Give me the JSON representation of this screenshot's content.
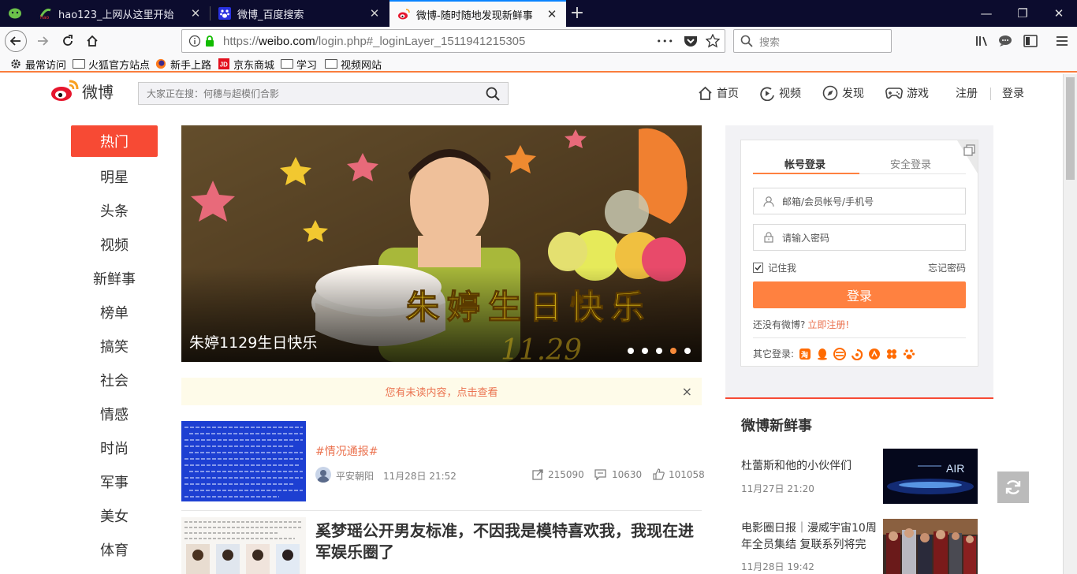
{
  "browser": {
    "tabs": [
      {
        "title": "hao123_上网从这里开始",
        "active": false
      },
      {
        "title": "微博_百度搜索",
        "active": false
      },
      {
        "title": "微博-随时随地发现新鲜事",
        "active": true
      }
    ],
    "new_tab": "+",
    "url_host_prefix": "https://",
    "url_host": "weibo.com",
    "url_path": "/login.php#_loginLayer_1511941215305",
    "search_placeholder": "搜索",
    "url_more": "•••",
    "bookmarks": [
      "最常访问",
      "火狐官方站点",
      "新手上路",
      "京东商城",
      "学习",
      "视频网站"
    ]
  },
  "weibo": {
    "logo_text": "微博",
    "search_placeholder": "大家正在搜：何穗与超模们合影",
    "topnav": [
      "首页",
      "视频",
      "发现",
      "游戏",
      "注册",
      "登录"
    ],
    "categories": [
      "热门",
      "明星",
      "头条",
      "视频",
      "新鲜事",
      "榜单",
      "搞笑",
      "社会",
      "情感",
      "时尚",
      "军事",
      "美女",
      "体育"
    ],
    "carousel": {
      "caption": "朱婷1129生日快乐",
      "overlay": "朱婷生日快乐",
      "date_hint": "11.29",
      "dots": 5,
      "active_dot": 3
    },
    "notice": {
      "text": "您有未读内容，点击查看",
      "close": "×"
    },
    "feed": [
      {
        "tag": "#情况通报#",
        "author": "平安朝阳",
        "time": "11月28日 21:52",
        "reposts": "215090",
        "comments": "10630",
        "likes": "101058"
      },
      {
        "title": "奚梦瑶公开男友标准，不因我是模特喜欢我，我现在进军娱乐圈了"
      }
    ],
    "login": {
      "tab_account": "帐号登录",
      "tab_secure": "安全登录",
      "username_placeholder": "邮箱/会员帐号/手机号",
      "password_placeholder": "请输入密码",
      "remember": "记住我",
      "forgot": "忘记密码",
      "submit": "登录",
      "no_account": "还没有微博?",
      "register_now": "立即注册!",
      "other_login": "其它登录:"
    },
    "fresh": {
      "title": "微博新鲜事",
      "items": [
        {
          "title": "杜蕾斯和他的小伙伴们",
          "date": "11月27日 21:20",
          "img_text": "AIR"
        },
        {
          "title": "电影圈日报｜漫威宇宙10周年全员集结 复联系列将完",
          "date": "11月28日 19:42"
        }
      ]
    }
  },
  "colors": {
    "accent": "#f74a34",
    "login_btn": "#ff8140",
    "link": "#eb7350",
    "tabbar": "#0c0c2e"
  }
}
